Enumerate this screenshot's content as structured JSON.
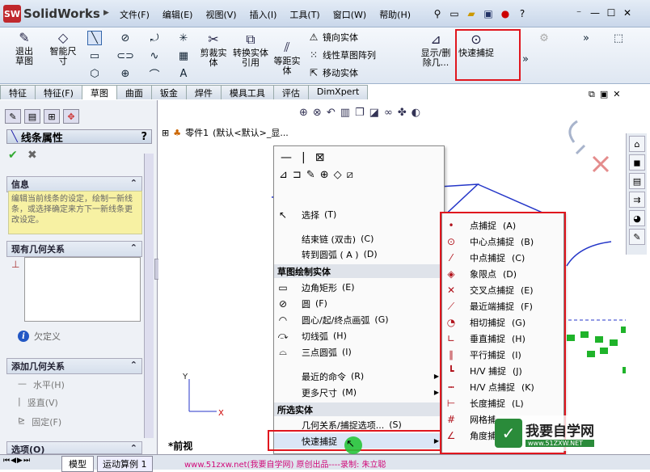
{
  "app": {
    "title": "SolidWorks",
    "logo_mark": "SW"
  },
  "menu": [
    "文件(F)",
    "编辑(E)",
    "视图(V)",
    "插入(I)",
    "工具(T)",
    "窗口(W)",
    "帮助(H)"
  ],
  "ribbon": {
    "exit_sketch": "退出草图",
    "smart_dim": "智能尺寸",
    "trim": "剪裁实体",
    "convert": "转换实体引用",
    "offset": "等距实体",
    "mirror": "镜向实体",
    "linear_pattern": "线性草图阵列",
    "move": "移动实体",
    "show_delete": "显示/删除几...",
    "quick_snap": "快速捕捉"
  },
  "tabs": [
    "特征",
    "特征(F)",
    "草图",
    "曲面",
    "钣金",
    "焊件",
    "模具工具",
    "评估",
    "DimXpert"
  ],
  "panel": {
    "title": "线条属性",
    "help": "?",
    "info_header": "信息",
    "info_text": "编辑当前线条的设定，绘制一新线条，或选择确定来方下一新线条更改设定。",
    "existing_header": "现有几何关系",
    "undefined": "欠定义",
    "add_header": "添加几何关系",
    "horizontal": "水平(H)",
    "vertical": "竖直(V)",
    "fix": "固定(F)",
    "options_header": "选项(O)"
  },
  "tree": {
    "label": "零件1",
    "config": "(默认<默认>_显..."
  },
  "view_label": "*前视",
  "context_menu": {
    "select": "选择",
    "select_key": "(T)",
    "end_chain": "结束链 (双击)",
    "end_chain_key": "(C)",
    "to_arc": "转到圆弧 ( A )",
    "to_arc_key": "(D)",
    "sketch_header": "草图绘制实体",
    "corner_rect": "边角矩形",
    "corner_rect_key": "(E)",
    "circle": "圆",
    "circle_key": "(F)",
    "center_arc": "圆心/起/终点画弧",
    "center_arc_key": "(G)",
    "tangent_arc": "切线弧",
    "tangent_arc_key": "(H)",
    "three_arc": "三点圆弧",
    "three_arc_key": "(I)",
    "recent": "最近的命令",
    "recent_key": "(R)",
    "more_dims": "更多尺寸",
    "more_dims_key": "(M)",
    "selected_header": "所选实体",
    "relations": "几何关系/捕捉选项...",
    "relations_key": "(S)",
    "quick_snaps": "快速捕捉"
  },
  "submenu": [
    {
      "label": "点捕捉",
      "key": "(A)",
      "icon": "•"
    },
    {
      "label": "中心点捕捉",
      "key": "(B)",
      "icon": "⊙"
    },
    {
      "label": "中点捕捉",
      "key": "(C)",
      "icon": "⁄"
    },
    {
      "label": "象限点",
      "key": "(D)",
      "icon": "◈"
    },
    {
      "label": "交叉点捕捉",
      "key": "(E)",
      "icon": "✕"
    },
    {
      "label": "最近端捕捉",
      "key": "(F)",
      "icon": "⟋"
    },
    {
      "label": "相切捕捉",
      "key": "(G)",
      "icon": "◔"
    },
    {
      "label": "垂直捕捉",
      "key": "(H)",
      "icon": "∟"
    },
    {
      "label": "平行捕捉",
      "key": "(I)",
      "icon": "∥"
    },
    {
      "label": "H/V 捕捉",
      "key": "(J)",
      "icon": "┗"
    },
    {
      "label": "H/V 点捕捉",
      "key": "(K)",
      "icon": "┅"
    },
    {
      "label": "长度捕捉",
      "key": "(L)",
      "icon": "⊢"
    },
    {
      "label": "网格捕",
      "key": "",
      "icon": "#"
    },
    {
      "label": "角度捕",
      "key": "",
      "icon": "∠"
    }
  ],
  "status": {
    "model_tab": "模型",
    "motion_tab": "运动算例 1",
    "watermark": "www.51zxw.net(我要自学网) 原创出品----录制: 朱立聪"
  },
  "site_logo": {
    "text": "我要自学网",
    "url": "www.51ZXW.NET"
  }
}
